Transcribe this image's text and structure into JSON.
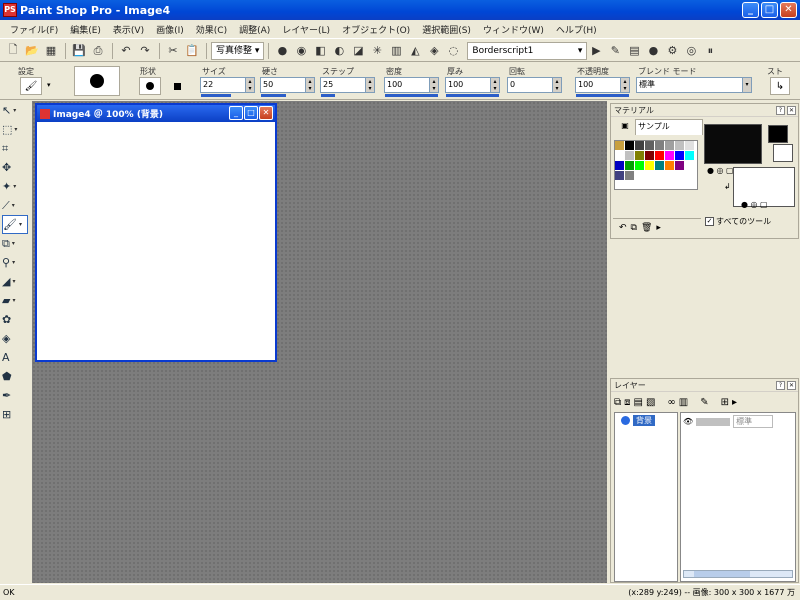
{
  "window": {
    "app_icon": "PS",
    "title": "Paint Shop Pro - Image4",
    "minimize": "_",
    "maximize": "□",
    "close": "✕"
  },
  "menu": [
    "ファイル(F)",
    "編集(E)",
    "表示(V)",
    "画像(I)",
    "効果(C)",
    "調整(A)",
    "レイヤー(L)",
    "オブジェクト(O)",
    "選択範囲(S)",
    "ウィンドウ(W)",
    "ヘルプ(H)"
  ],
  "toolbar": {
    "photo_fix": "写真修整",
    "script_value": "Borderscript1"
  },
  "tool_options": {
    "preset_label": "設定",
    "shape_label": "形状",
    "size_label": "サイズ",
    "size_value": "22",
    "hardness_label": "硬さ",
    "hardness_value": "50",
    "step_label": "ステップ",
    "step_value": "25",
    "density_label": "密度",
    "density_value": "100",
    "thickness_label": "厚み",
    "thickness_value": "100",
    "rotation_label": "回転",
    "rotation_value": "0",
    "opacity_label": "不透明度",
    "opacity_value": "100",
    "blend_label": "ブレンド モード",
    "blend_value": "標準",
    "stroke_label": "スト"
  },
  "image_window": {
    "title": "Image4 ＠ 100% (背景)"
  },
  "materials": {
    "title": "マテリアル",
    "sample_tab": "サンプル",
    "all_tools_label": "すべてのツール",
    "colors": [
      "#c8a040",
      "#000000",
      "#404040",
      "#606060",
      "#808080",
      "#a0a0a0",
      "#c0c0c0",
      "#e0e0e0",
      "#ffffff",
      "#c0c0c0",
      "#808000",
      "#800000",
      "#ff0000",
      "#ff00ff",
      "#0000ff",
      "#00ffff",
      "#0000c0",
      "#00a000",
      "#00ff00",
      "#ffff00",
      "#008080",
      "#ff8000",
      "#800080",
      "#ffffff",
      "#404080",
      "#808080"
    ],
    "foreground_color": "#0a0a0a",
    "background_color": "#ffffff"
  },
  "layers": {
    "title": "レイヤー",
    "layer_name": "背景",
    "mode": "標準"
  },
  "status": {
    "left": "OK",
    "right": "(x:289 y:249) -- 画像: 300 x 300 x 1677 万"
  }
}
